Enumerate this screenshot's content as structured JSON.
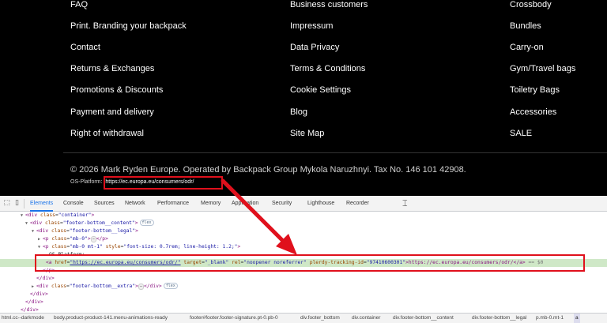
{
  "footer": {
    "col1": [
      "FAQ",
      "Print. Branding your backpack",
      "Contact",
      "Returns & Exchanges",
      "Promotions & Discounts",
      "Payment and delivery",
      "Right of withdrawal"
    ],
    "col2": [
      "Business customers",
      "Impressum",
      "Data Privacy",
      "Terms & Conditions",
      "Cookie Settings",
      "Blog",
      "Site Map"
    ],
    "col3": [
      "Crossbody",
      "Bundles",
      "Carry-on",
      "Gym/Travel bags",
      "Toiletry Bags",
      "Accessories",
      "SALE"
    ],
    "copyright": "© 2026 Mark Ryden Europe. Operated by Backpack Group Mykola Naruzhnyi. Tax No. 146 101 42908.",
    "os_label": "OS-Platform:",
    "os_link": "https://ec.europa.eu/consumers/odr/"
  },
  "devtools": {
    "tabs": [
      "Elements",
      "Console",
      "Sources",
      "Network",
      "Performance",
      "Memory",
      "Application",
      "Security",
      "Lighthouse",
      "Recorder"
    ],
    "active_tab": "Elements",
    "tree": {
      "r0_tag": "<div ",
      "r0_attr": "class",
      "r0_val": "\"container\"",
      "r0_end": ">",
      "r1_tag": "<div ",
      "r1_attr": "class",
      "r1_val": "\"footer-bottom__content\"",
      "r1_end": ">",
      "r1_badge": "flex",
      "r2_tag": "<div ",
      "r2_attr": "class",
      "r2_val": "\"footer-bottom__legal\"",
      "r2_end": ">",
      "r3_tag": "<p ",
      "r3_attr": "class",
      "r3_val": "\"mb-0\"",
      "r3_mid": ">",
      "r3_ell": "⋯",
      "r3_end": "</p>",
      "r4_tag": "<p ",
      "r4_attr": "class",
      "r4_val": "\"mb-0 mt-1\"",
      "r4_attr2": "style",
      "r4_val2": "\"font-size: 0.7rem; line-height: 1.2;\"",
      "r4_end": ">",
      "r5_text": "OS-Platform:",
      "r6_tag": "<a ",
      "r6_a1": "href",
      "r6_v1": "\"https://ec.europa.eu/consumers/odr/\"",
      "r6_a2": "target",
      "r6_v2": "\"_blank\"",
      "r6_a3": "rel",
      "r6_v3": "\"noopener noreferrer\"",
      "r6_a4": "plerdy-tracking-id",
      "r6_v4": "\"97410600301\"",
      "r6_text": ">https://ec.europa.eu/consumers/odr/</a>",
      "r6_eq": " == $0",
      "r7": "</p>",
      "r8": "</div>",
      "r9_tag": "<div ",
      "r9_attr": "class",
      "r9_val": "\"footer-bottom__extra\"",
      "r9_mid": ">",
      "r9_ell": "⋯",
      "r9_end": "</div>",
      "r9_badge": "flex",
      "r10": "</div>",
      "r11": "</div>",
      "r12": "</div>"
    },
    "breadcrumbs": [
      "html.cc--darkmode",
      "body.product-product-141.menu-animations-ready",
      "footer#footer.footer-signature.pt-0.pb-0",
      "div.footer_bottom",
      "div.container",
      "div.footer-bottom__content",
      "div.footer-bottom__legal",
      "p.mb-0.mt-1",
      "a"
    ]
  },
  "colors": {
    "annotation_red": "#e0101c",
    "selection_green": "#cfe8c7",
    "link_blue": "#1a1aa6",
    "tag_purple": "#881280"
  }
}
